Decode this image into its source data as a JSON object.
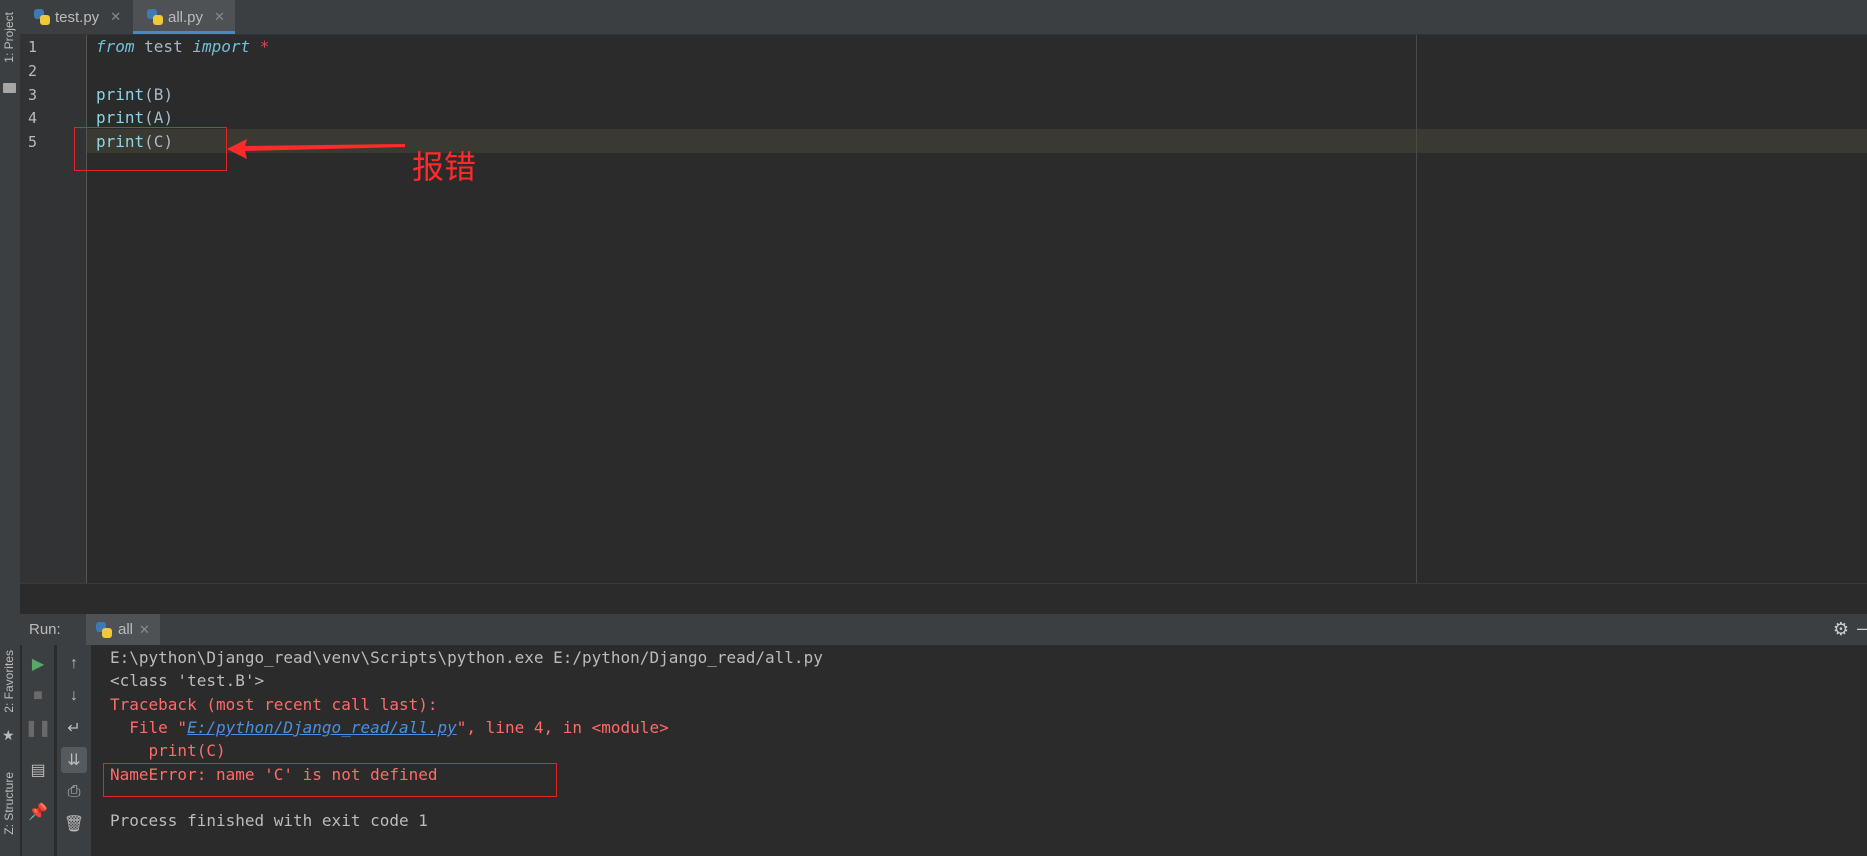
{
  "side_tools": {
    "project": "1: Project",
    "favorites": "2: Favorites",
    "structure": "Z: Structure"
  },
  "tabs": [
    {
      "label": "test.py",
      "close": "✕",
      "active": false
    },
    {
      "label": "all.py",
      "close": "✕",
      "active": true
    }
  ],
  "editor": {
    "line_numbers": [
      "1",
      "2",
      "3",
      "4",
      "5"
    ],
    "lines": {
      "l1": {
        "kw1": "from",
        "mod": " test ",
        "kw2": "import",
        "star": " *"
      },
      "l3": {
        "fn": "print",
        "arg": "(B)"
      },
      "l4": {
        "fn": "print",
        "arg": "(A)"
      },
      "l5": {
        "fn": "print",
        "arg": "(C)"
      }
    }
  },
  "annotation": {
    "label": "报错",
    "color": "#ff2a2a"
  },
  "run_panel": {
    "label": "Run:",
    "tab_label": "all",
    "tab_close": "✕"
  },
  "console": {
    "cmd": "E:\\python\\Django_read\\venv\\Scripts\\python.exe E:/python/Django_read/all.py",
    "out1": "<class 'test.B'>",
    "traceback": "Traceback (most recent call last):",
    "file_prefix": "  File \"",
    "file_link": "E:/python/Django_read/all.py",
    "file_suffix": "\", line 4, in <module>",
    "code": "    print(C)",
    "error": "NameError: name 'C' is not defined",
    "exit": "Process finished with exit code 1"
  },
  "colors": {
    "editor_bg": "#2b2b2b",
    "keyword": "#6fc2d6",
    "error_text": "#ff6b68",
    "link": "#4a90e2",
    "tab_underline": "#4a88c7"
  }
}
